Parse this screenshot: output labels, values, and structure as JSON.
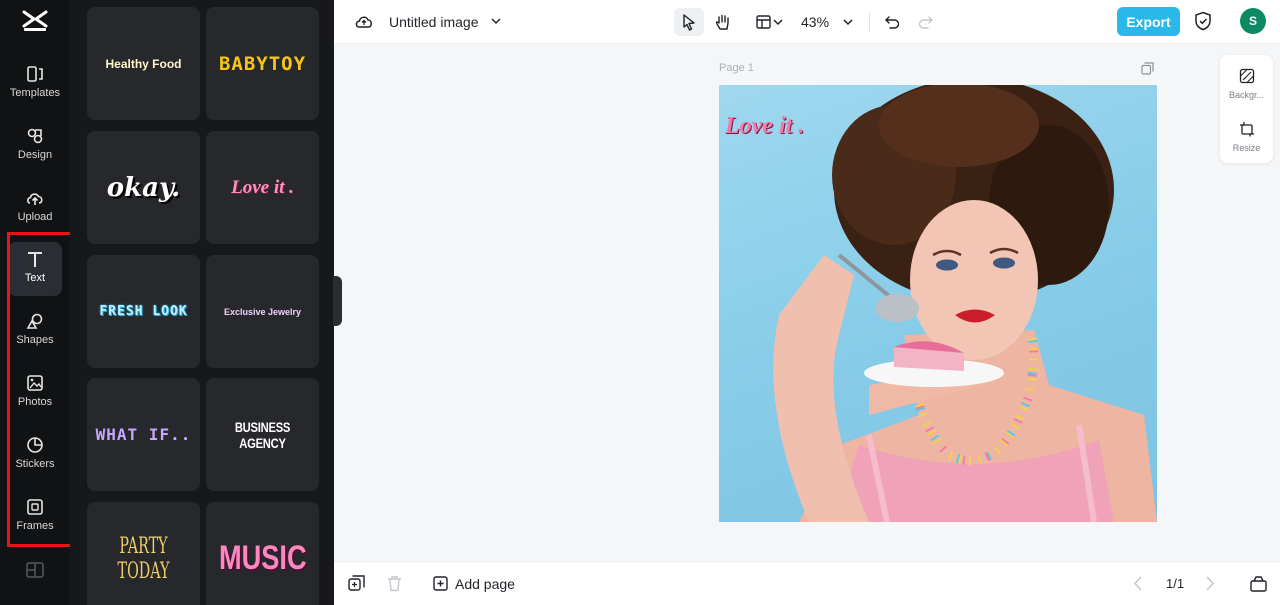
{
  "nav": {
    "items": [
      {
        "id": "templates",
        "label": "Templates",
        "icon": "templates-icon"
      },
      {
        "id": "design",
        "label": "Design",
        "icon": "design-icon"
      },
      {
        "id": "upload",
        "label": "Upload",
        "icon": "upload-icon"
      },
      {
        "id": "text",
        "label": "Text",
        "icon": "text-icon",
        "active": true
      },
      {
        "id": "shapes",
        "label": "Shapes",
        "icon": "shapes-icon"
      },
      {
        "id": "photos",
        "label": "Photos",
        "icon": "photos-icon"
      },
      {
        "id": "stickers",
        "label": "Stickers",
        "icon": "stickers-icon"
      },
      {
        "id": "frames",
        "label": "Frames",
        "icon": "frames-icon"
      }
    ],
    "highlight_color": "#e8141b"
  },
  "text_templates": [
    "Healthy Food",
    "BABYTOY",
    "okay.",
    "Love it .",
    "FRESH LOOK",
    "Exclusive Jewelry",
    "WHAT IF..",
    "BUSINESS AGENCY",
    "PARTY TODAY",
    "MUSIC"
  ],
  "header": {
    "title": "Untitled image",
    "zoom": "43%",
    "export_label": "Export",
    "avatar_initial": "S",
    "accent_color": "#2ab7ea"
  },
  "canvas": {
    "page_label": "Page 1",
    "overlay_text": "Love it ."
  },
  "side_tools": {
    "background_label": "Backgr...",
    "resize_label": "Resize"
  },
  "footer": {
    "add_page_label": "Add page",
    "page_indicator": "1/1"
  }
}
